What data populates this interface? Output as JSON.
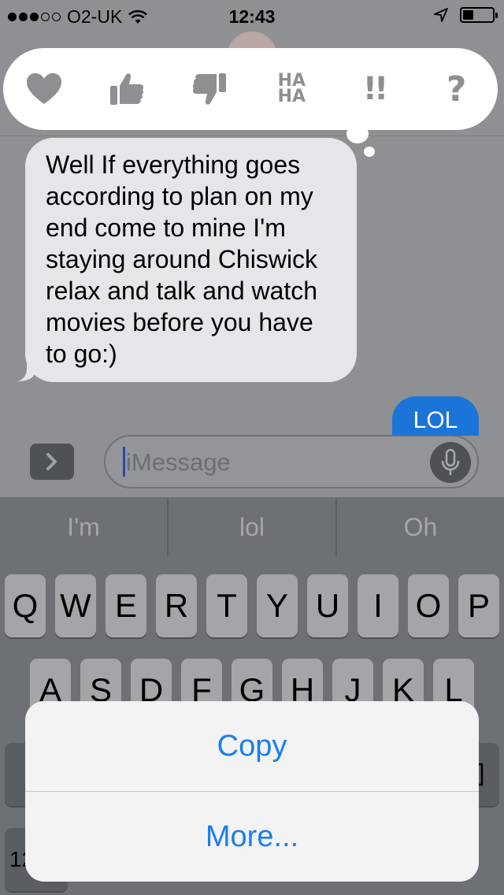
{
  "status_bar": {
    "signal_dots_filled": 3,
    "signal_dots_total": 5,
    "carrier": "O2-UK",
    "time": "12:43",
    "battery_level": 0.35
  },
  "tapback": {
    "items": [
      {
        "name": "heart-icon"
      },
      {
        "name": "thumbs-up-icon"
      },
      {
        "name": "thumbs-down-icon"
      },
      {
        "name": "haha-icon",
        "line1": "HA",
        "line2": "HA"
      },
      {
        "name": "exclamation-icon",
        "text": "!!"
      },
      {
        "name": "question-icon",
        "text": "?"
      }
    ]
  },
  "message": {
    "text": "Well If everything goes according to plan on my end come to mine I'm staying around Chiswick relax and talk and watch movies before you have to go:)",
    "sent_partial": "LOL"
  },
  "input": {
    "placeholder": "iMessage"
  },
  "predictive": [
    "I'm",
    "lol",
    "Oh"
  ],
  "keyboard": {
    "row1": [
      "Q",
      "W",
      "E",
      "R",
      "T",
      "Y",
      "U",
      "I",
      "O",
      "P"
    ],
    "row2": [
      "A",
      "S",
      "D",
      "F",
      "G",
      "H",
      "J",
      "K",
      "L"
    ],
    "numbers_key_partial": "12"
  },
  "action_sheet": {
    "copy_label": "Copy",
    "more_label": "More..."
  },
  "colors": {
    "accent_blue": "#1a7ef0",
    "bubble_gray": "#e5e5ea",
    "sent_blue": "#1b74d8"
  }
}
